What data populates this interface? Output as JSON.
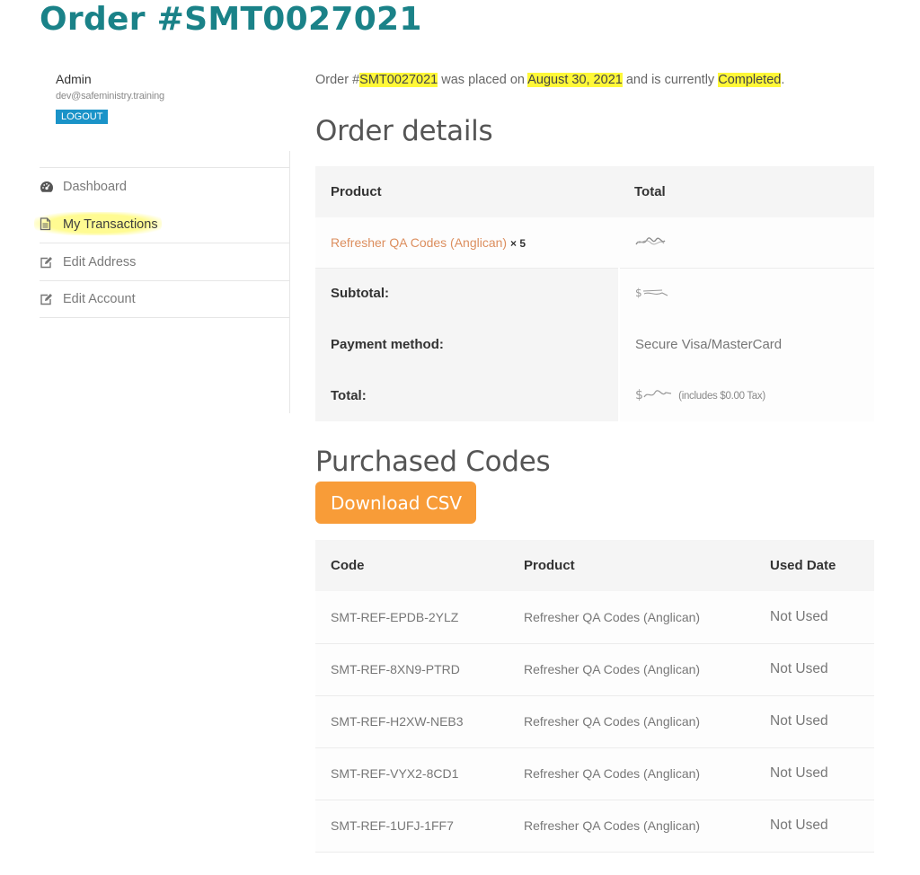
{
  "page": {
    "title": "Order #SMT0027021"
  },
  "sidebar": {
    "user_name": "Admin",
    "user_email": "dev@safeministry.training",
    "logout_label": "LOGOUT",
    "nav": [
      {
        "label": "Dashboard",
        "icon": "dashboard-gauge-icon",
        "active": false
      },
      {
        "label": "My Transactions",
        "icon": "document-icon",
        "active": true
      },
      {
        "label": "Edit Address",
        "icon": "edit-icon",
        "active": false
      },
      {
        "label": "Edit Account",
        "icon": "edit-icon",
        "active": false
      }
    ]
  },
  "summary": {
    "prefix": "Order #",
    "order_number": "SMT0027021",
    "placed_text": " was placed on ",
    "date": "August 30, 2021",
    "status_text": " and is currently ",
    "status": "Completed",
    "suffix": "."
  },
  "order_details": {
    "heading": "Order details",
    "columns": [
      "Product",
      "Total"
    ],
    "items": [
      {
        "product": "Refresher QA Codes (Anglican)",
        "quantity": "× 5",
        "total": "[redacted]"
      }
    ],
    "footer": [
      {
        "label": "Subtotal:",
        "value": "[redacted]"
      },
      {
        "label": "Payment method:",
        "value": "Secure Visa/MasterCard"
      },
      {
        "label": "Total:",
        "value": "[redacted]",
        "note": "(includes $0.00 Tax)"
      }
    ]
  },
  "purchased_codes": {
    "heading": "Purchased Codes",
    "download_label": "Download CSV",
    "columns": [
      "Code",
      "Product",
      "Used Date"
    ],
    "rows": [
      {
        "code": "SMT-REF-EPDB-2YLZ",
        "product": "Refresher QA Codes (Anglican)",
        "used_date": "Not Used"
      },
      {
        "code": "SMT-REF-8XN9-PTRD",
        "product": "Refresher QA Codes (Anglican)",
        "used_date": "Not Used"
      },
      {
        "code": "SMT-REF-H2XW-NEB3",
        "product": "Refresher QA Codes (Anglican)",
        "used_date": "Not Used"
      },
      {
        "code": "SMT-REF-VYX2-8CD1",
        "product": "Refresher QA Codes (Anglican)",
        "used_date": "Not Used"
      },
      {
        "code": "SMT-REF-1UFJ-1FF7",
        "product": "Refresher QA Codes (Anglican)",
        "used_date": "Not Used"
      }
    ]
  },
  "colors": {
    "title": "#1a8288",
    "logout_button": "#1a93c8",
    "download_button": "#f89c38",
    "product_link": "#dc8e5e",
    "highlight": "#fff838"
  }
}
